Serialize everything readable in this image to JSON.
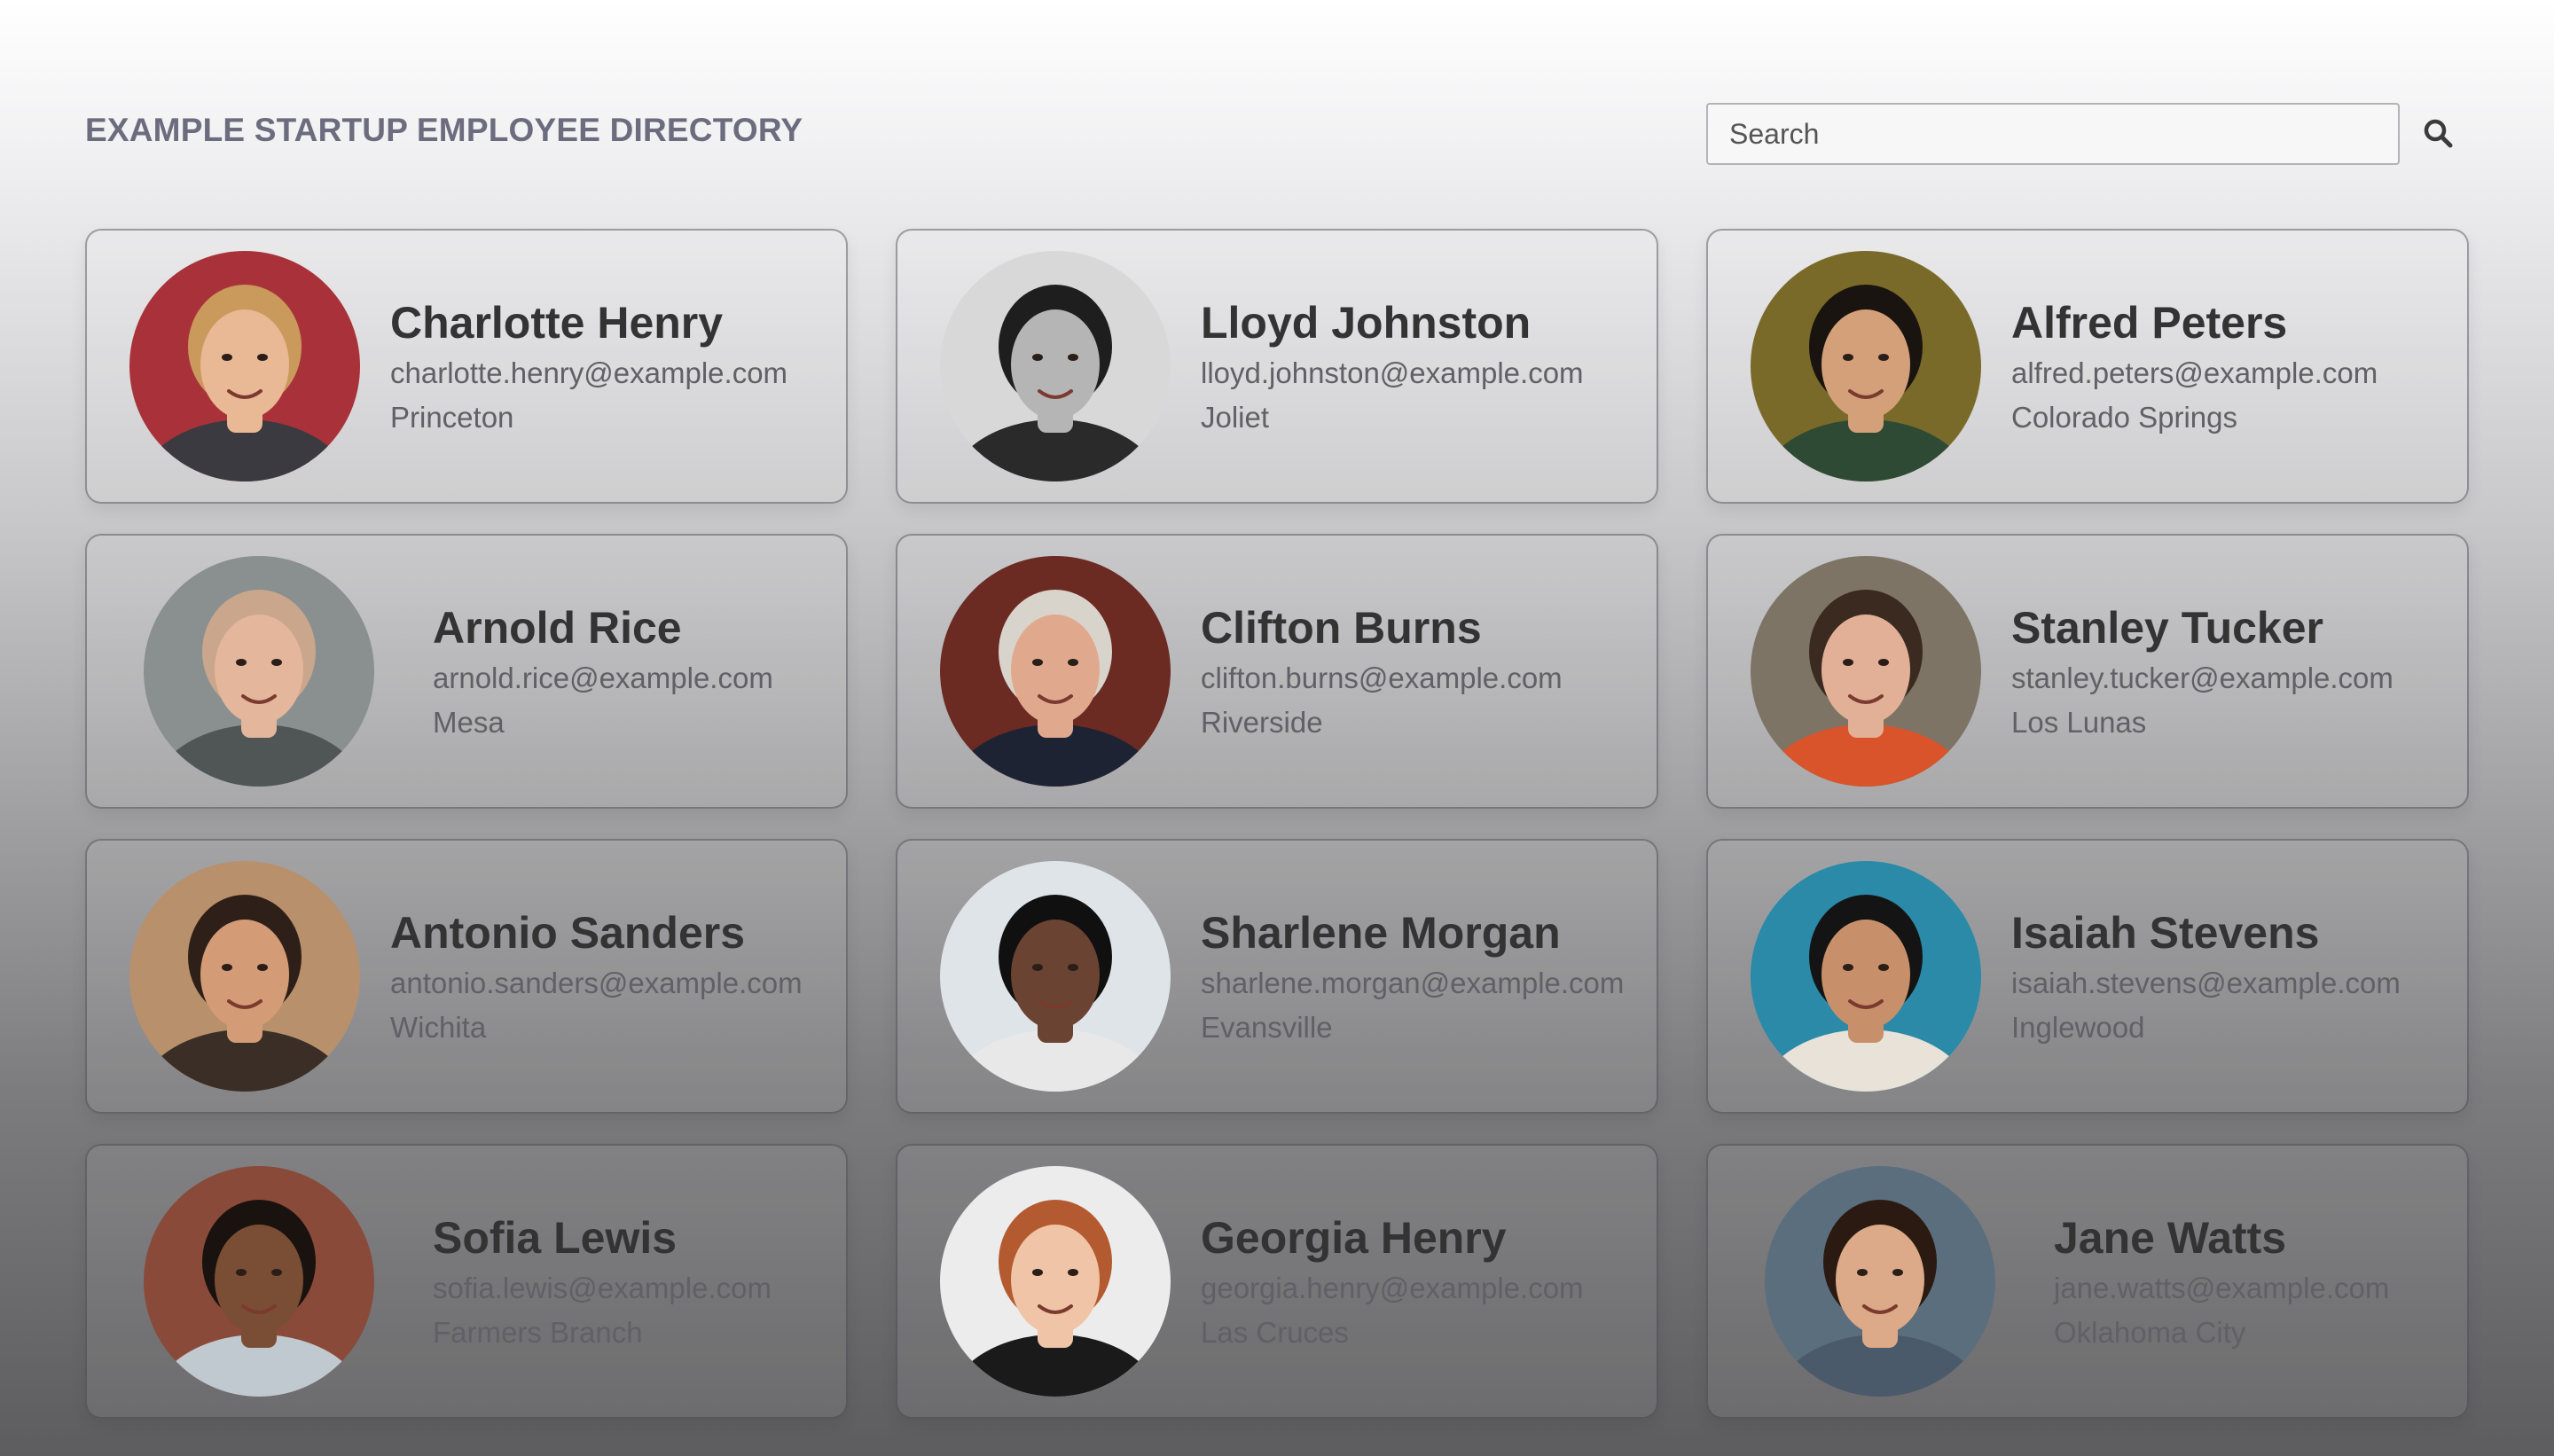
{
  "header": {
    "title": "EXAMPLE STARTUP EMPLOYEE DIRECTORY",
    "search_placeholder": "Search",
    "search_icon": "magnifier-icon"
  },
  "employees": [
    {
      "name": "Charlotte Henry",
      "email": "charlotte.henry@example.com",
      "city": "Princeton",
      "photo": {
        "bg": "#a9323a",
        "skin": "#e9b894",
        "hair": "#c99a5c",
        "shirt": "#3b3a40"
      }
    },
    {
      "name": "Lloyd Johnston",
      "email": "lloyd.johnston@example.com",
      "city": "Joliet",
      "photo": {
        "bg": "#d8d8d8",
        "skin": "#b5b5b5",
        "hair": "#1e1e1e",
        "shirt": "#2a2a2a"
      }
    },
    {
      "name": "Alfred Peters",
      "email": "alfred.peters@example.com",
      "city": "Colorado Springs",
      "photo": {
        "bg": "#7a6a2a",
        "skin": "#d3a07a",
        "hair": "#1a1410",
        "shirt": "#2f4a34"
      }
    },
    {
      "name": "Arnold Rice",
      "email": "arnold.rice@example.com",
      "city": "Mesa",
      "photo": {
        "bg": "#8a8f90",
        "skin": "#e4b69c",
        "hair": "#c9a68c",
        "shirt": "#505656"
      }
    },
    {
      "name": "Clifton Burns",
      "email": "clifton.burns@example.com",
      "city": "Riverside",
      "photo": {
        "bg": "#6b2a22",
        "skin": "#e0a98e",
        "hair": "#d8d4cc",
        "shirt": "#1e2334"
      }
    },
    {
      "name": "Stanley Tucker",
      "email": "stanley.tucker@example.com",
      "city": "Los Lunas",
      "photo": {
        "bg": "#7d7466",
        "skin": "#e2b096",
        "hair": "#3a2a20",
        "shirt": "#d9542a"
      }
    },
    {
      "name": "Antonio Sanders",
      "email": "antonio.sanders@example.com",
      "city": "Wichita",
      "photo": {
        "bg": "#b8906c",
        "skin": "#d39c76",
        "hair": "#2e2018",
        "shirt": "#3a2e26"
      }
    },
    {
      "name": "Sharlene Morgan",
      "email": "sharlene.morgan@example.com",
      "city": "Evansville",
      "photo": {
        "bg": "#dfe4e8",
        "skin": "#6a4332",
        "hair": "#101010",
        "shirt": "#e8e8e8"
      }
    },
    {
      "name": "Isaiah Stevens",
      "email": "isaiah.stevens@example.com",
      "city": "Inglewood",
      "photo": {
        "bg": "#2a8aa8",
        "skin": "#c8906a",
        "hair": "#141414",
        "shirt": "#e8e2d8"
      }
    },
    {
      "name": "Sofia Lewis",
      "email": "sofia.lewis@example.com",
      "city": "Farmers Branch",
      "photo": {
        "bg": "#8a4a3a",
        "skin": "#7a4e34",
        "hair": "#1a120e",
        "shirt": "#c0c8d0"
      }
    },
    {
      "name": "Georgia Henry",
      "email": "georgia.henry@example.com",
      "city": "Las Cruces",
      "photo": {
        "bg": "#ececec",
        "skin": "#f0c4a6",
        "hair": "#b45a30",
        "shirt": "#1a1a1a"
      }
    },
    {
      "name": "Jane Watts",
      "email": "jane.watts@example.com",
      "city": "Oklahoma City",
      "photo": {
        "bg": "#5a6e7e",
        "skin": "#dcaa88",
        "hair": "#2a1a12",
        "shirt": "#4a5a6a"
      }
    }
  ]
}
